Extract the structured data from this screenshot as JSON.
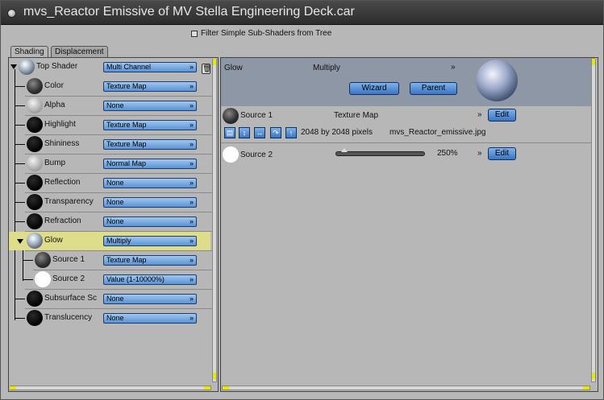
{
  "window": {
    "title": "mvs_Reactor Emissive of MV Stella Engineering Deck.car"
  },
  "filter": {
    "label": "Filter Simple Sub-Shaders from Tree"
  },
  "tabs": [
    {
      "label": "Shading"
    },
    {
      "label": "Displacement"
    }
  ],
  "tree": [
    {
      "label": "Top Shader",
      "value": "Multi Channel"
    },
    {
      "label": "Color",
      "value": "Texture Map"
    },
    {
      "label": "Alpha",
      "value": "None"
    },
    {
      "label": "Highlight",
      "value": "Texture Map"
    },
    {
      "label": "Shininess",
      "value": "Texture Map"
    },
    {
      "label": "Bump",
      "value": "Normal Map"
    },
    {
      "label": "Reflection",
      "value": "None"
    },
    {
      "label": "Transparency",
      "value": "None"
    },
    {
      "label": "Refraction",
      "value": "None"
    },
    {
      "label": "Glow",
      "value": "Multiply"
    },
    {
      "label": "Source 1",
      "value": "Texture Map"
    },
    {
      "label": "Source 2",
      "value": "Value (1-10000%)"
    },
    {
      "label": "Subsurface Sc",
      "value": "None"
    },
    {
      "label": "Translucency",
      "value": "None"
    }
  ],
  "detail": {
    "channel": "Glow",
    "mode": "Multiply",
    "wizard_label": "Wizard",
    "parent_label": "Parent",
    "source1": {
      "label": "Source 1",
      "type": "Texture Map",
      "edit_label": "Edit",
      "dimensions": "2048 by 2048 pixels",
      "filename": "mvs_Reactor_emissive.jpg"
    },
    "source2": {
      "label": "Source 2",
      "value": "250%",
      "edit_label": "Edit",
      "slider_fraction": 0.1
    }
  },
  "icons": {
    "open": "folder-open-icon",
    "flip_v": "flip-vertical-icon",
    "flip_h": "flip-horizontal-icon",
    "rotate": "rotate-icon",
    "up": "arrow-up-icon"
  },
  "colors": {
    "selected_row": "#dede8a",
    "button_blue": "#5a93d6",
    "header_bg": "#8e97a6"
  }
}
